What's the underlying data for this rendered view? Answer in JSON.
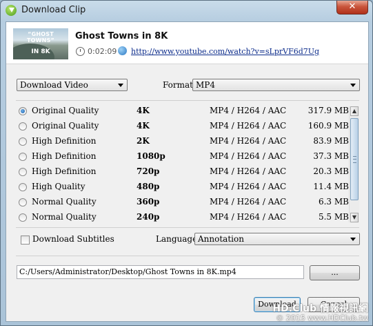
{
  "window": {
    "title": "Download Clip",
    "close_glyph": "✕"
  },
  "clip": {
    "title": "Ghost Towns in 8K",
    "duration": "0:02:09",
    "url": "http://www.youtube.com/watch?v=sLprVF6d7Ug",
    "thumbnail": {
      "line1": "“GHOST TOWNS”",
      "line2": "IN 8K"
    }
  },
  "controls": {
    "action_select": "Download Video",
    "format_label": "Format:",
    "format_select": "MP4",
    "subtitles_label": "Download Subtitles",
    "subtitles_checked": false,
    "language_label": "Language:",
    "language_select": "Annotation",
    "save_path": "C:/Users/Administrator/Desktop/Ghost Towns in 8K.mp4",
    "browse_label": "...",
    "download_label": "Download",
    "cancel_label": "Cancel"
  },
  "quality_options": [
    {
      "quality": "Original Quality",
      "resolution": "4K",
      "format": "MP4 / H264 / AAC",
      "size": "317.9 MB",
      "selected": true
    },
    {
      "quality": "Original Quality",
      "resolution": "4K",
      "format": "MP4 / H264 / AAC",
      "size": "160.9 MB",
      "selected": false
    },
    {
      "quality": "High Definition",
      "resolution": "2K",
      "format": "MP4 / H264 / AAC",
      "size": "83.9 MB",
      "selected": false
    },
    {
      "quality": "High Definition",
      "resolution": "1080p",
      "format": "MP4 / H264 / AAC",
      "size": "37.3 MB",
      "selected": false
    },
    {
      "quality": "High Definition",
      "resolution": "720p",
      "format": "MP4 / H264 / AAC",
      "size": "20.3 MB",
      "selected": false
    },
    {
      "quality": "High Quality",
      "resolution": "480p",
      "format": "MP4 / H264 / AAC",
      "size": "11.4 MB",
      "selected": false
    },
    {
      "quality": "Normal Quality",
      "resolution": "360p",
      "format": "MP4 / H264 / AAC",
      "size": "6.3 MB",
      "selected": false
    },
    {
      "quality": "Normal Quality",
      "resolution": "240p",
      "format": "MP4 / H264 / AAC",
      "size": "5.5 MB",
      "selected": false
    }
  ],
  "watermark": {
    "line1": "HD.Club 情報視訊網",
    "line2": "© 2015 www.HDClub.tw"
  }
}
